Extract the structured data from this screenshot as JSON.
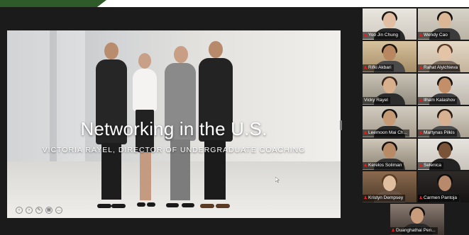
{
  "presentation": {
    "title": "Networking in the U.S.",
    "subtitle": "VICTORIA RAYEL, DIRECTOR OF UNDERGRADUATE COACHING",
    "controls": [
      "previous-icon",
      "next-icon",
      "pen-icon",
      "grid-icon",
      "more-icon"
    ]
  },
  "participants": [
    {
      "name": "Yoo Jin Chung",
      "muted": true,
      "active": false
    },
    {
      "name": "Wendy Cao",
      "muted": true,
      "active": false
    },
    {
      "name": "Rifki Akbari",
      "muted": true,
      "active": false
    },
    {
      "name": "Rahat Alyichieva",
      "muted": true,
      "active": false
    },
    {
      "name": "Vicky Rayel",
      "muted": false,
      "active": true
    },
    {
      "name": "Ilham Kalashov",
      "muted": true,
      "active": false
    },
    {
      "name": "Leemoon Mai Ch...",
      "muted": true,
      "active": false
    },
    {
      "name": "Martynas Pilkis",
      "muted": true,
      "active": false
    },
    {
      "name": "Kerelos Soliman",
      "muted": true,
      "active": false
    },
    {
      "name": "Selenica",
      "muted": true,
      "active": false
    },
    {
      "name": "Kristyn Dempsey",
      "muted": true,
      "active": false
    },
    {
      "name": "Carmen Pantoja",
      "muted": true,
      "active": false
    },
    {
      "name": "Duanghathai Pen...",
      "muted": true,
      "active": false
    }
  ],
  "colors": {
    "active_speaker_border": "#e3ef3a",
    "muted_icon": "#e02020",
    "window_bg": "#1b1b1b"
  }
}
